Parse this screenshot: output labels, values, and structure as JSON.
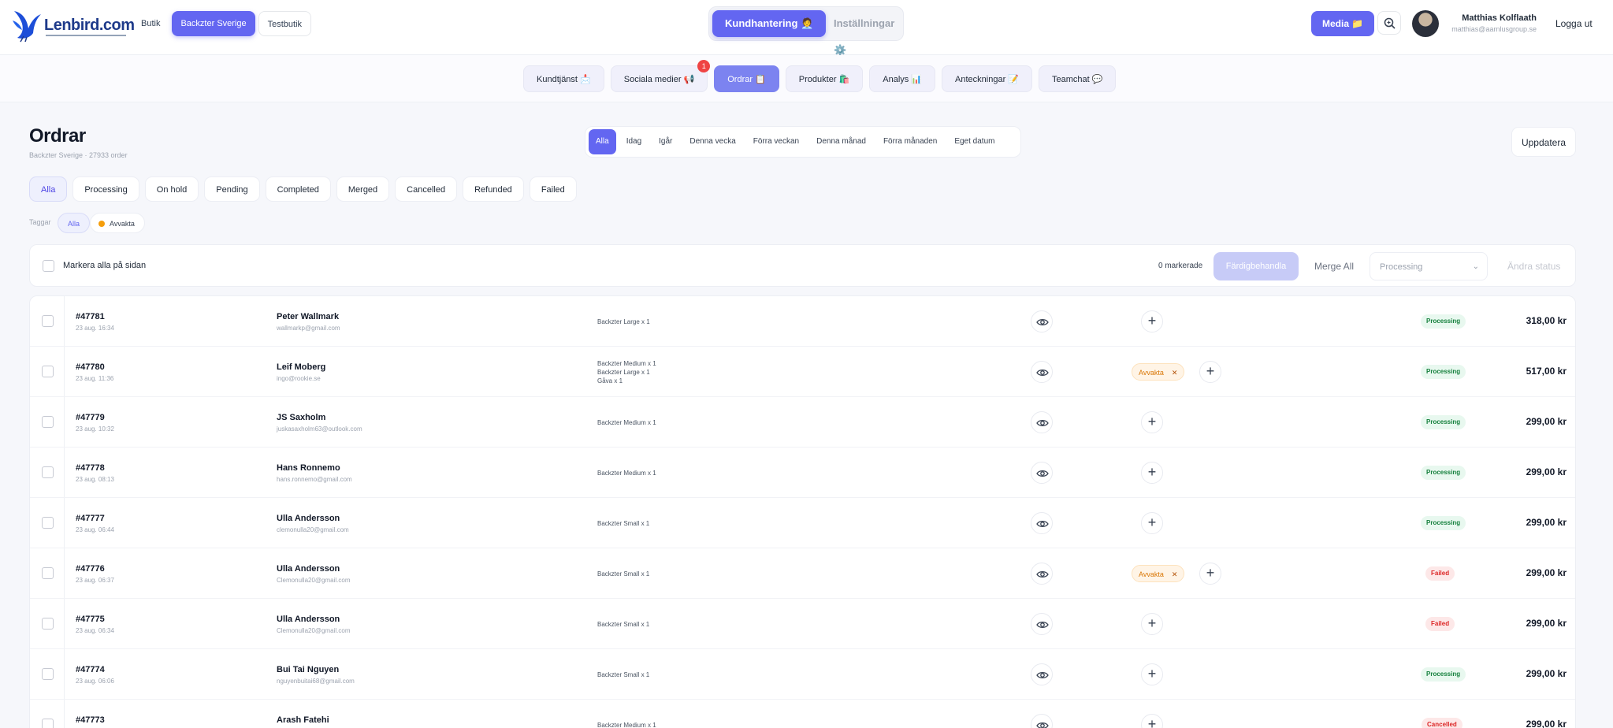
{
  "header": {
    "logo": "Lenbird.com",
    "shops": [
      {
        "label": "Butik",
        "active": false
      },
      {
        "label": "Backzter Sverige",
        "active": true
      },
      {
        "label": "Testbutik",
        "active": false
      }
    ],
    "modes": [
      {
        "label": "Kundhantering 🧑‍💼",
        "active": true
      },
      {
        "label": "Inställningar ⚙️",
        "active": false
      }
    ],
    "media_label": "Media 📁",
    "user": {
      "name": "Matthias Kolflaath",
      "email": "matthias@aarnlusgroup.se"
    },
    "logout_label": "Logga ut"
  },
  "modules": [
    {
      "label": "Kundtjänst 📩",
      "active": false,
      "badge": ""
    },
    {
      "label": "Sociala medier 📢",
      "active": false,
      "badge": "1"
    },
    {
      "label": "Ordrar 📋",
      "active": true,
      "badge": ""
    },
    {
      "label": "Produkter 🛍️",
      "active": false,
      "badge": ""
    },
    {
      "label": "Analys 📊",
      "active": false,
      "badge": ""
    },
    {
      "label": "Anteckningar 📝",
      "active": false,
      "badge": ""
    },
    {
      "label": "Teamchat 💬",
      "active": false,
      "badge": ""
    }
  ],
  "page": {
    "title": "Ordrar",
    "subtitle": "Backzter Sverige · 27933 order",
    "date_filters": [
      {
        "label": "Alla",
        "active": true
      },
      {
        "label": "Idag",
        "active": false
      },
      {
        "label": "Igår",
        "active": false
      },
      {
        "label": "Denna vecka",
        "active": false
      },
      {
        "label": "Förra veckan",
        "active": false
      },
      {
        "label": "Denna månad",
        "active": false
      },
      {
        "label": "Förra månaden",
        "active": false
      },
      {
        "label": "Eget datum",
        "active": false
      }
    ],
    "refresh_label": "Uppdatera"
  },
  "status_filters": [
    {
      "label": "Alla",
      "active": true
    },
    {
      "label": "Processing",
      "active": false
    },
    {
      "label": "On hold",
      "active": false
    },
    {
      "label": "Pending",
      "active": false
    },
    {
      "label": "Completed",
      "active": false
    },
    {
      "label": "Merged",
      "active": false
    },
    {
      "label": "Cancelled",
      "active": false
    },
    {
      "label": "Refunded",
      "active": false
    },
    {
      "label": "Failed",
      "active": false
    }
  ],
  "tags": {
    "label": "Taggar",
    "all": "Alla",
    "avvakta": "Avvakta"
  },
  "bulk": {
    "select_all_label": "Markera alla på sidan",
    "selected_count": "0 markerade",
    "finish_label": "Färdigbehandla",
    "merge_label": "Merge All",
    "status_select_value": "Processing",
    "change_status_label": "Ändra status"
  },
  "orders": [
    {
      "number": "#47781",
      "date": "23 aug. 16:34",
      "name": "Peter Wallmark",
      "email": "wallmarkp@gmail.com",
      "items": [
        "Backzter Large x 1"
      ],
      "tag": "",
      "status": "Processing",
      "amount": "318,00 kr"
    },
    {
      "number": "#47780",
      "date": "23 aug. 11:36",
      "name": "Leif Moberg",
      "email": "ingo@rookie.se",
      "items": [
        "Backzter Medium x 1",
        "Backzter Large x 1",
        "Gåva x 1"
      ],
      "tag": "Avvakta",
      "status": "Processing",
      "amount": "517,00 kr"
    },
    {
      "number": "#47779",
      "date": "23 aug. 10:32",
      "name": "JS Saxholm",
      "email": "juskasaxholm63@outlook.com",
      "items": [
        "Backzter Medium x 1"
      ],
      "tag": "",
      "status": "Processing",
      "amount": "299,00 kr"
    },
    {
      "number": "#47778",
      "date": "23 aug. 08:13",
      "name": "Hans Ronnemo",
      "email": "hans.ronnemo@gmail.com",
      "items": [
        "Backzter Medium x 1"
      ],
      "tag": "",
      "status": "Processing",
      "amount": "299,00 kr"
    },
    {
      "number": "#47777",
      "date": "23 aug. 06:44",
      "name": "Ulla Andersson",
      "email": "clemonulla20@gmail.com",
      "items": [
        "Backzter Small x 1"
      ],
      "tag": "",
      "status": "Processing",
      "amount": "299,00 kr"
    },
    {
      "number": "#47776",
      "date": "23 aug. 06:37",
      "name": "Ulla Andersson",
      "email": "Clemonulla20@gmail.com",
      "items": [
        "Backzter Small x 1"
      ],
      "tag": "Avvakta",
      "status": "Failed",
      "amount": "299,00 kr"
    },
    {
      "number": "#47775",
      "date": "23 aug. 06:34",
      "name": "Ulla Andersson",
      "email": "Clemonulla20@gmail.com",
      "items": [
        "Backzter Small x 1"
      ],
      "tag": "",
      "status": "Failed",
      "amount": "299,00 kr"
    },
    {
      "number": "#47774",
      "date": "23 aug. 06:06",
      "name": "Bui Tai Nguyen",
      "email": "nguyenbuitai68@gmail.com",
      "items": [
        "Backzter Small x 1"
      ],
      "tag": "",
      "status": "Processing",
      "amount": "299,00 kr"
    },
    {
      "number": "#47773",
      "date": "",
      "name": "Arash Fatehi",
      "email": "",
      "items": [
        "Backzter Medium x 1"
      ],
      "tag": "",
      "status": "Cancelled",
      "amount": "299,00 kr"
    }
  ],
  "colors": {
    "accent": "#6366f1",
    "processing": "#15803d",
    "failed": "#dc2626",
    "tag": "#d97706"
  }
}
